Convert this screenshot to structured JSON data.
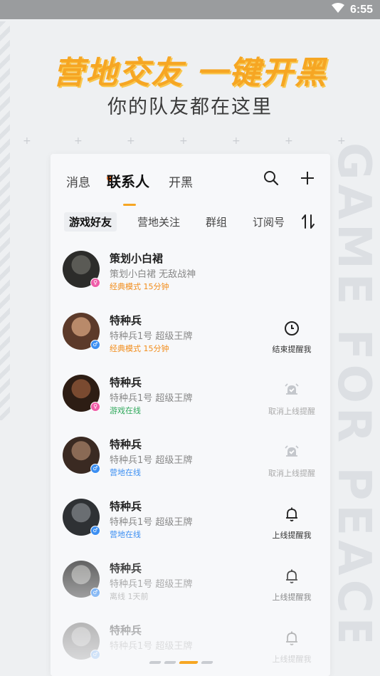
{
  "status_bar": {
    "time": "6:55"
  },
  "hero": {
    "title": "营地交友 一键开黑",
    "subtitle": "你的队友都在这里"
  },
  "background": {
    "deco_text": "GAME FOR PEACE"
  },
  "tabs": [
    {
      "label": "消息",
      "has_badge": true
    },
    {
      "label": "联系人",
      "active": true
    },
    {
      "label": "开黑"
    }
  ],
  "toolbar": {
    "search_icon": "search-icon",
    "add_icon": "plus-icon"
  },
  "filters": [
    {
      "label": "游戏好友",
      "active": true
    },
    {
      "label": "营地关注"
    },
    {
      "label": "群组"
    },
    {
      "label": "订阅号"
    }
  ],
  "contacts": [
    {
      "name": "策划小白裙",
      "sub": "策划小白裙   无敌战神",
      "status": "经典模式 15分钟",
      "status_color": "orange",
      "gender": "female",
      "action": null
    },
    {
      "name": "特种兵",
      "sub": "特种兵1号   超级王牌",
      "status": "经典模式 15分钟",
      "status_color": "orange",
      "gender": "male",
      "action": {
        "label": "结束提醒我",
        "icon": "clock-icon",
        "dim": false
      }
    },
    {
      "name": "特种兵",
      "sub": "特种兵1号   超级王牌",
      "status": "游戏在线",
      "status_color": "green",
      "gender": "female",
      "action": {
        "label": "取消上线提醒",
        "icon": "bell-check-icon",
        "dim": true
      }
    },
    {
      "name": "特种兵",
      "sub": "特种兵1号   超级王牌",
      "status": "营地在线",
      "status_color": "blue",
      "gender": "male",
      "action": {
        "label": "取消上线提醒",
        "icon": "bell-check-icon",
        "dim": true
      }
    },
    {
      "name": "特种兵",
      "sub": "特种兵1号   超级王牌",
      "status": "营地在线",
      "status_color": "blue",
      "gender": "male",
      "action": {
        "label": "上线提醒我",
        "icon": "bell-icon",
        "dim": false
      }
    },
    {
      "name": "特种兵",
      "sub": "特种兵1号   超级王牌",
      "status": "离线 1天前",
      "status_color": "gray",
      "gender": "male",
      "action": {
        "label": "上线提醒我",
        "icon": "bell-icon",
        "dim": false
      }
    },
    {
      "name": "特种兵",
      "sub": "特种兵1号   超级王牌",
      "status": "",
      "status_color": "gray",
      "gender": "male",
      "action": {
        "label": "上线提醒我",
        "icon": "bell-icon",
        "dim": false
      }
    }
  ],
  "pager": {
    "count": 4,
    "active_index": 2
  }
}
